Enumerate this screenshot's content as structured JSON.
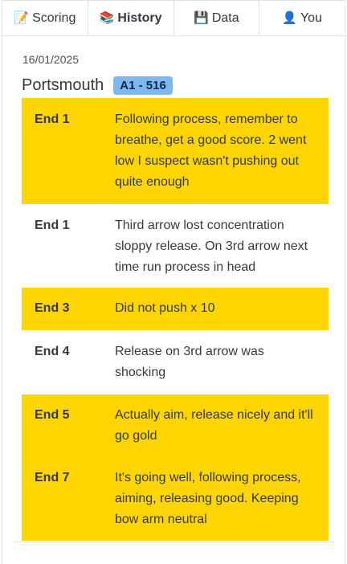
{
  "tabs": [
    {
      "icon": "📝",
      "icon_name": "memo-icon",
      "label": "Scoring",
      "active": false
    },
    {
      "icon": "📚",
      "icon_name": "books-icon",
      "label": "History",
      "active": true
    },
    {
      "icon": "💾",
      "icon_name": "floppy-disk-icon",
      "label": "Data",
      "active": false
    },
    {
      "icon": "👤",
      "icon_name": "user-icon",
      "label": "You",
      "active": false
    }
  ],
  "session": {
    "date": "16/01/2025",
    "venue": "Portsmouth",
    "badge": "A1 - 516"
  },
  "notes": [
    {
      "end": "End 1",
      "text": "Following process, remember to breathe, get a good score. 2 went low I suspect wasn't pushing out quite enough",
      "highlight": true
    },
    {
      "end": "End 1",
      "text": "Third arrow lost concentration sloppy release. On 3rd arrow next time run process in head",
      "highlight": false
    },
    {
      "end": "End 3",
      "text": "Did not push x 10",
      "highlight": true
    },
    {
      "end": "End 4",
      "text": "Release on 3rd arrow was shocking",
      "highlight": false
    },
    {
      "end": "End 5",
      "text": "Actually aim, release nicely and it'll go gold",
      "highlight": true
    },
    {
      "end": "End 7",
      "text": "It's going well, following process, aiming, releasing good. Keeping bow arm neutral",
      "highlight": true
    }
  ],
  "colors": {
    "highlight": "#ffd500",
    "badge_bg": "#7fb8ef"
  }
}
